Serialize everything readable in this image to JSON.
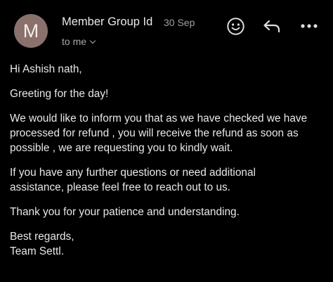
{
  "header": {
    "avatar_letter": "M",
    "sender": "Member Group Id",
    "date": "30 Sep",
    "recipient": "to me"
  },
  "actions": {
    "icons": [
      "smiley-icon",
      "reply-icon",
      "more-icon"
    ]
  },
  "message": {
    "greeting": "Hi Ashish nath,",
    "line1": "Greeting for the day!",
    "para1_line1": "We would like to inform you that as we have checked we have",
    "para1_line2": "processed for refund , you will receive the refund as soon as",
    "para1_line3": "possible , we are requesting you to kindly wait.",
    "para2_line1": "If you have any further questions or need additional",
    "para2_line2": "assistance, please feel free to reach out to us.",
    "para3": "Thank you for your patience and understanding.",
    "signoff": "Best regards,",
    "signature": "Team Settl."
  },
  "colors": {
    "background": "#000000",
    "avatar": "#8a716b",
    "text": "#e8e8e8",
    "muted": "#a0a0a0"
  }
}
